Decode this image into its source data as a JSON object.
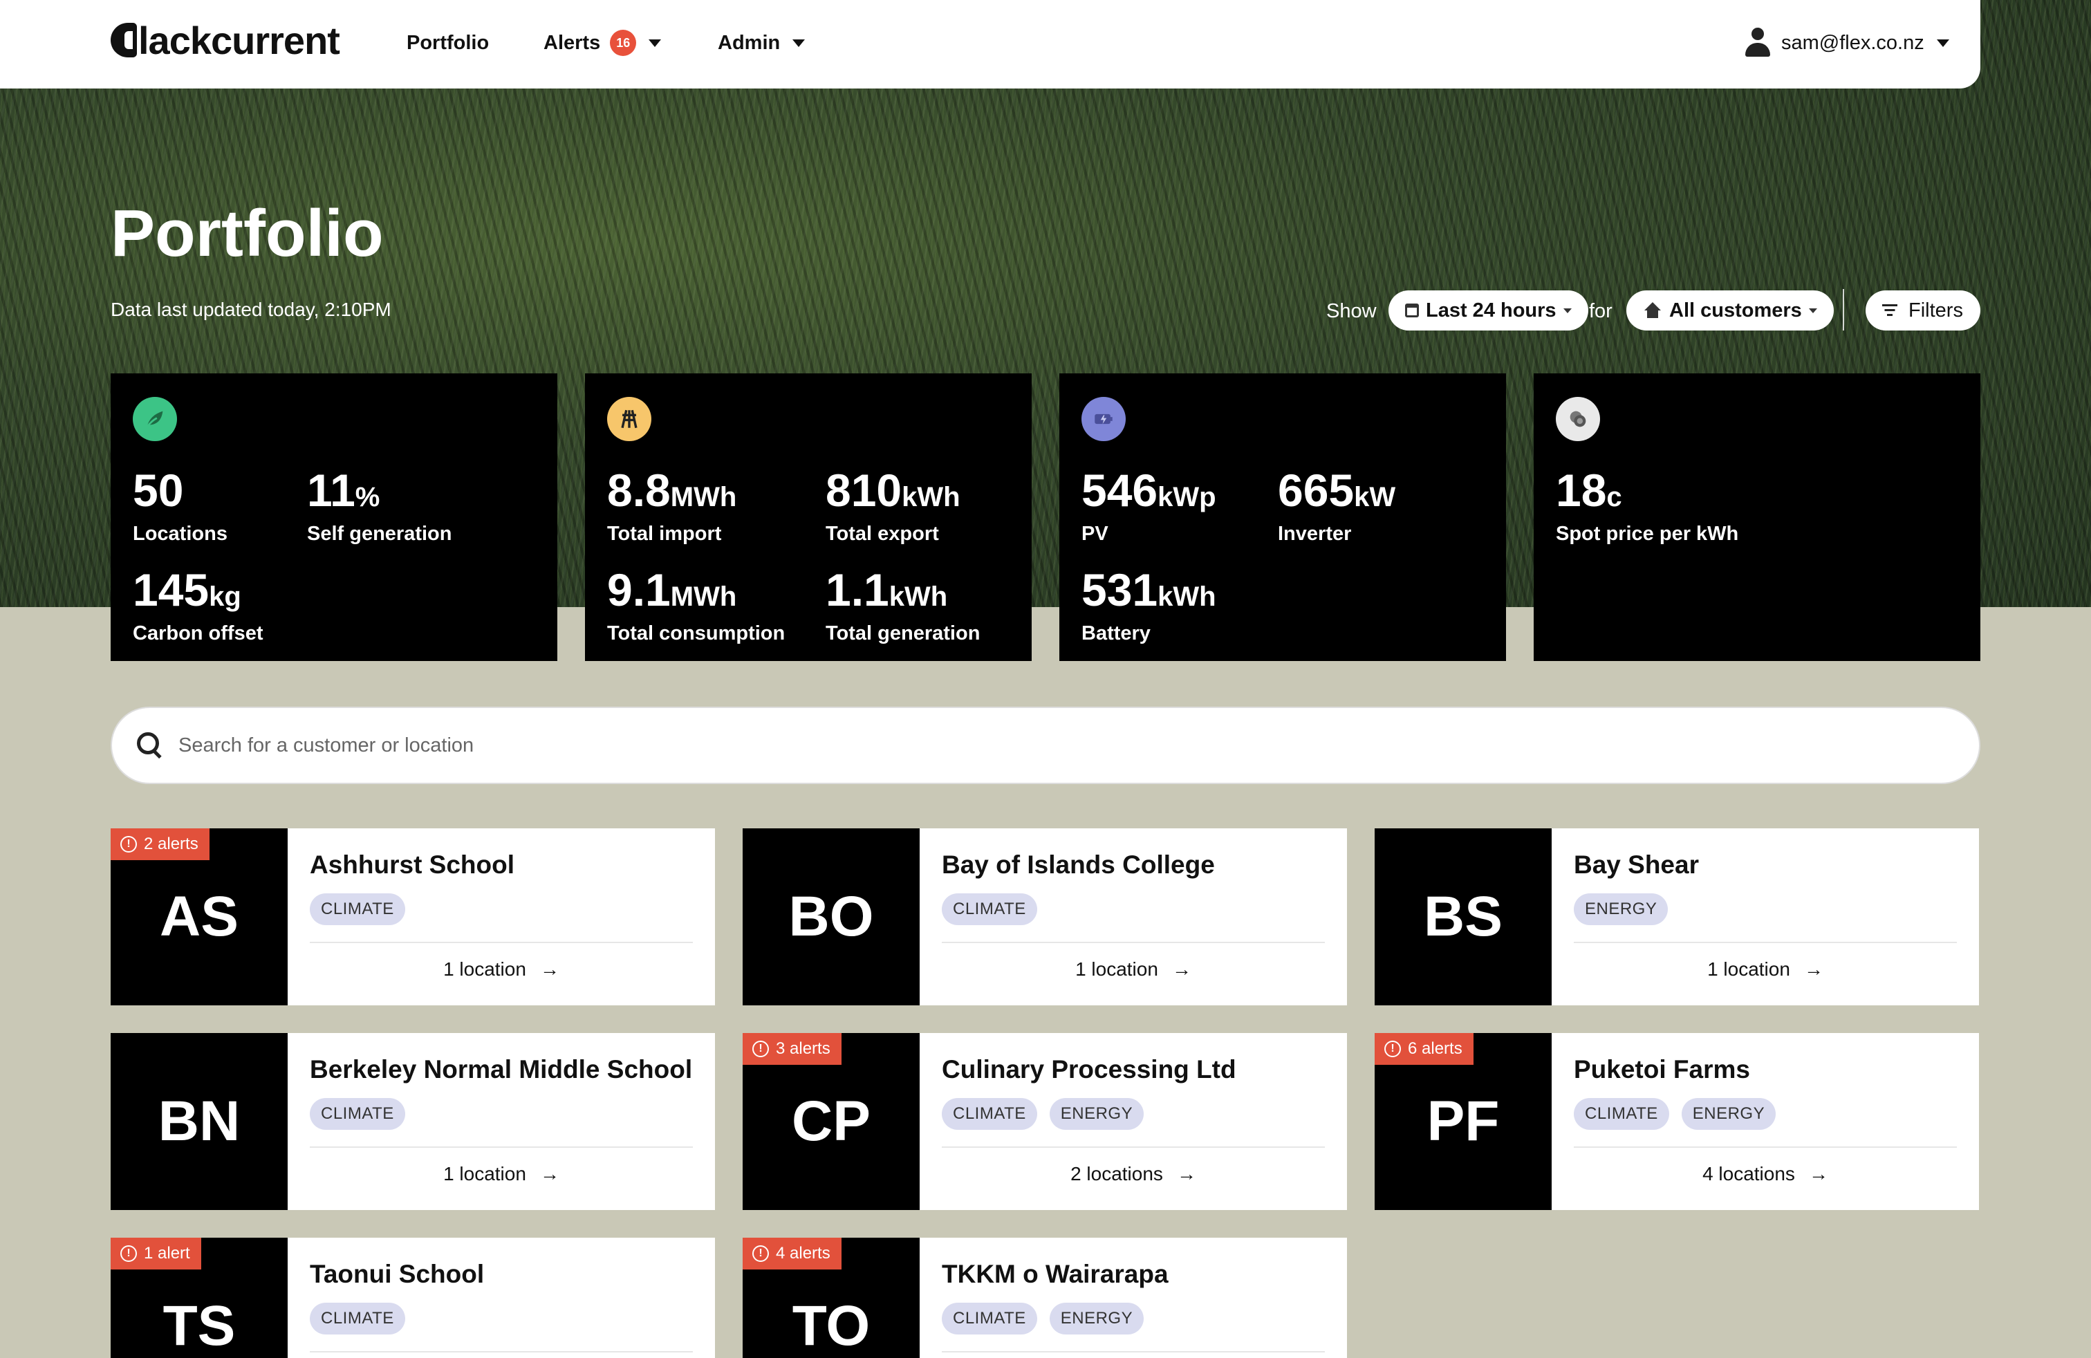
{
  "nav": {
    "logo": "Blackcurrent",
    "logo_text": "lackcurrent",
    "portfolio": "Portfolio",
    "alerts": "Alerts",
    "alerts_count": "16",
    "admin": "Admin",
    "user": "sam@flex.co.nz"
  },
  "hero": {
    "title": "Portfolio",
    "updated": "Data last updated today, 2:10PM",
    "show_label": "Show",
    "period": "Last 24 hours",
    "for_label": "for",
    "customers": "All customers",
    "filters": "Filters"
  },
  "stats": {
    "climate": {
      "icon": "leaf-icon",
      "color": "#3cc486",
      "locations": {
        "value": "50",
        "unit": "",
        "label": "Locations"
      },
      "self_gen": {
        "value": "11",
        "unit": "%",
        "label": "Self generation"
      },
      "carbon": {
        "value": "145",
        "unit": "kg",
        "label": "Carbon offset"
      }
    },
    "energy": {
      "icon": "power-icon",
      "color": "#f7c66b",
      "import": {
        "value": "8.8",
        "unit": "MWh",
        "label": "Total import"
      },
      "export": {
        "value": "810",
        "unit": "kWh",
        "label": "Total export"
      },
      "consumption": {
        "value": "9.1",
        "unit": "MWh",
        "label": "Total consumption"
      },
      "generation": {
        "value": "1.1",
        "unit": "kWh",
        "label": "Total generation"
      }
    },
    "capacity": {
      "icon": "battery-icon",
      "color": "#7f86d8",
      "pv": {
        "value": "546",
        "unit": "kWp",
        "label": "PV"
      },
      "inverter": {
        "value": "665",
        "unit": "kW",
        "label": "Inverter"
      },
      "battery": {
        "value": "531",
        "unit": "kWh",
        "label": "Battery"
      }
    },
    "price": {
      "icon": "coins-icon",
      "color": "#e9e9e9",
      "spot": {
        "value": "18",
        "unit": "c",
        "label": "Spot price per kWh"
      }
    }
  },
  "search": {
    "placeholder": "Search for a customer or location"
  },
  "customers": [
    {
      "initials": "AS",
      "name": "Ashhurst School",
      "tags": [
        "CLIMATE"
      ],
      "locations": "1 location",
      "alerts": "2 alerts"
    },
    {
      "initials": "BO",
      "name": "Bay of Islands College",
      "tags": [
        "CLIMATE"
      ],
      "locations": "1 location",
      "alerts": ""
    },
    {
      "initials": "BS",
      "name": "Bay Shear",
      "tags": [
        "ENERGY"
      ],
      "locations": "1 location",
      "alerts": ""
    },
    {
      "initials": "BN",
      "name": "Berkeley Normal Middle School",
      "tags": [
        "CLIMATE"
      ],
      "locations": "1 location",
      "alerts": ""
    },
    {
      "initials": "CP",
      "name": "Culinary Processing Ltd",
      "tags": [
        "CLIMATE",
        "ENERGY"
      ],
      "locations": "2 locations",
      "alerts": "3 alerts"
    },
    {
      "initials": "PF",
      "name": "Puketoi Farms",
      "tags": [
        "CLIMATE",
        "ENERGY"
      ],
      "locations": "4 locations",
      "alerts": "6 alerts"
    },
    {
      "initials": "TS",
      "name": "Taonui School",
      "tags": [
        "CLIMATE"
      ],
      "locations": "",
      "alerts": "1 alert"
    },
    {
      "initials": "TO",
      "name": "TKKM o Wairarapa",
      "tags": [
        "CLIMATE",
        "ENERGY"
      ],
      "locations": "",
      "alerts": "4 alerts"
    }
  ]
}
